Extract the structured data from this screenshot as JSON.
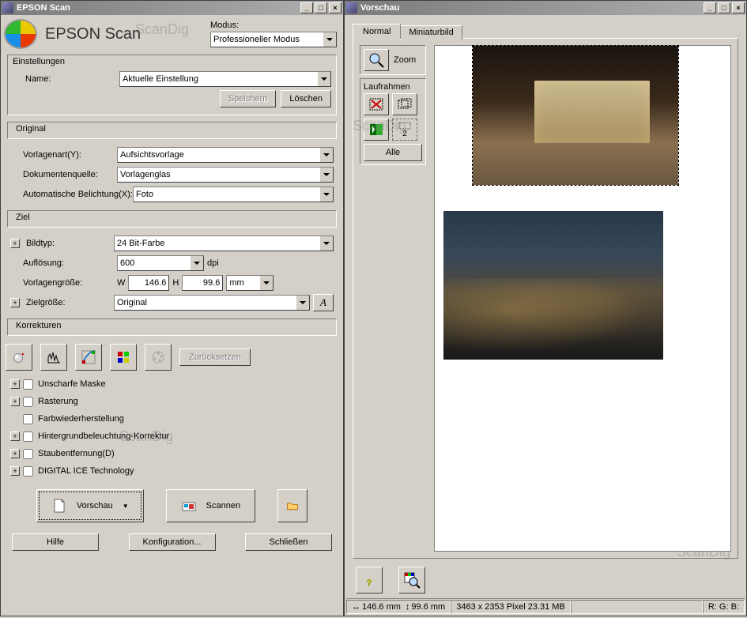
{
  "watermark": "ScanDig",
  "left": {
    "title": "EPSON Scan",
    "appTitle": "EPSON Scan",
    "mode": {
      "label": "Modus:",
      "value": "Professioneller Modus"
    },
    "settings": {
      "title": "Einstellungen",
      "nameLabel": "Name:",
      "nameValue": "Aktuelle Einstellung",
      "save": "Speichern",
      "delete": "Löschen"
    },
    "original": {
      "title": "Original",
      "docTypeLabel": "Vorlagenart(Y):",
      "docTypeValue": "Aufsichtsvorlage",
      "sourceLabel": "Dokumentenquelle:",
      "sourceValue": "Vorlagenglas",
      "autoExpLabel": "Automatische Belichtung(X):",
      "autoExpValue": "Foto"
    },
    "dest": {
      "title": "Ziel",
      "imageTypeLabel": "Bildtyp:",
      "imageTypeValue": "24 Bit-Farbe",
      "resLabel": "Auflösung:",
      "resValue": "600",
      "resUnit": "dpi",
      "docSizeLabel": "Vorlagengröße:",
      "wLabel": "W",
      "wValue": "146.6",
      "hLabel": "H",
      "hValue": "99.6",
      "unit": "mm",
      "targetSizeLabel": "Zielgröße:",
      "targetSizeValue": "Original"
    },
    "corrections": {
      "title": "Korrekturen",
      "reset": "Zurücksetzen",
      "unsharp": "Unscharfe Maske",
      "descreen": "Rasterung",
      "colorRestore": "Farbwiederherstellung",
      "backlight": "Hintergrundbeleuchtung-Korrektur",
      "dust": "Staubentfernung(D)",
      "ice": "DIGITAL ICE Technology"
    },
    "actions": {
      "preview": "Vorschau",
      "scan": "Scannen"
    },
    "footer": {
      "help": "Hilfe",
      "config": "Konfiguration...",
      "close": "Schließen"
    }
  },
  "right": {
    "title": "Vorschau",
    "tabs": {
      "normal": "Normal",
      "thumb": "Miniaturbild"
    },
    "zoom": "Zoom",
    "marquee": {
      "title": "Laufrahmen",
      "count": "2",
      "all": "Alle"
    },
    "status": {
      "w": "146.6 mm",
      "h": "99.6 mm",
      "px": "3463 x 2353 Pixel 23.31 MB",
      "rgb": "R:  G:  B:"
    }
  }
}
